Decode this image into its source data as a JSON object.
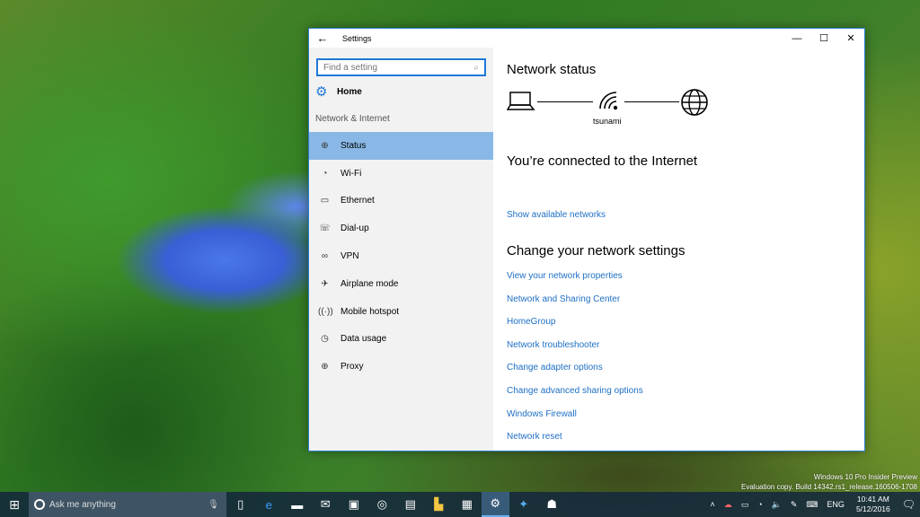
{
  "window": {
    "title": "Settings",
    "back_icon": "back-arrow-icon",
    "controls": {
      "minimize": "minimize-icon",
      "maximize": "maximize-icon",
      "close": "close-icon"
    }
  },
  "sidebar": {
    "search": {
      "placeholder": "Find a setting",
      "value": ""
    },
    "home_label": "Home",
    "section_label": "Network & Internet",
    "items": [
      {
        "label": "Status",
        "icon": "status-globe-icon",
        "glyph": "⊕",
        "active": true
      },
      {
        "label": "Wi-Fi",
        "icon": "wifi-icon",
        "glyph": "◔",
        "active": false
      },
      {
        "label": "Ethernet",
        "icon": "ethernet-icon",
        "glyph": "▭",
        "active": false
      },
      {
        "label": "Dial-up",
        "icon": "dialup-icon",
        "glyph": "☏",
        "active": false
      },
      {
        "label": "VPN",
        "icon": "vpn-icon",
        "glyph": "∞",
        "active": false
      },
      {
        "label": "Airplane mode",
        "icon": "airplane-icon",
        "glyph": "✈",
        "active": false
      },
      {
        "label": "Mobile hotspot",
        "icon": "hotspot-icon",
        "glyph": "((·))",
        "active": false
      },
      {
        "label": "Data usage",
        "icon": "data-usage-icon",
        "glyph": "◷",
        "active": false
      },
      {
        "label": "Proxy",
        "icon": "proxy-globe-icon",
        "glyph": "⊕",
        "active": false
      }
    ]
  },
  "main": {
    "network_status_title": "Network status",
    "network_name": "tsunami",
    "connection_status": "You’re connected to the Internet",
    "show_networks_link": "Show available networks",
    "change_title": "Change your network settings",
    "links": [
      "View your network properties",
      "Network and Sharing Center",
      "HomeGroup",
      "Network troubleshooter",
      "Change adapter options",
      "Change advanced sharing options",
      "Windows Firewall",
      "Network reset"
    ]
  },
  "taskbar": {
    "search_placeholder": "Ask me anything",
    "apps": [
      {
        "name": "task-view-icon",
        "glyph": "▯"
      },
      {
        "name": "edge-icon",
        "glyph": "e"
      },
      {
        "name": "file-explorer-icon",
        "glyph": "▬"
      },
      {
        "name": "mail-icon",
        "glyph": "✉"
      },
      {
        "name": "store-icon",
        "glyph": "▣"
      },
      {
        "name": "webcam-icon",
        "glyph": "◎"
      },
      {
        "name": "movies-icon",
        "glyph": "▤"
      },
      {
        "name": "folder-icon",
        "glyph": "▙"
      },
      {
        "name": "office-icon",
        "glyph": "▦"
      },
      {
        "name": "settings-icon",
        "glyph": "⚙",
        "active": true
      },
      {
        "name": "twitter-icon",
        "glyph": "✦"
      },
      {
        "name": "people-icon",
        "glyph": "☗"
      }
    ],
    "tray": {
      "language": "ENG",
      "time": "10:41 AM",
      "date": "5/12/2016"
    }
  },
  "watermark": {
    "line1": "Windows 10 Pro Insider Preview",
    "line2": "Evaluation copy. Build 14342.rs1_release.160506-1708"
  }
}
